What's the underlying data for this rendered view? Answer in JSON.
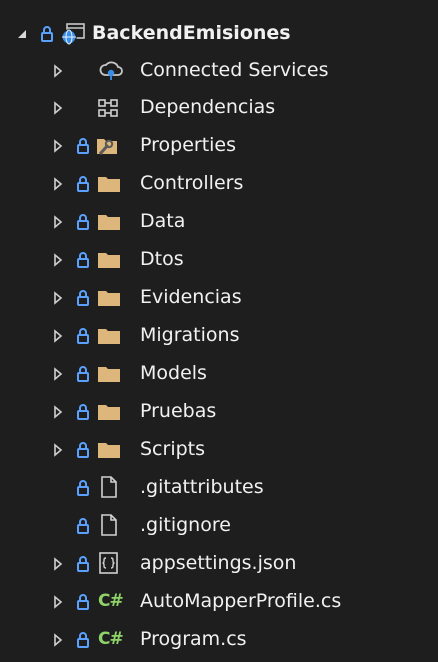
{
  "tree": {
    "project": {
      "name": "BackendEmisiones"
    },
    "items": [
      {
        "label": "Connected Services",
        "icon": "connected-services-icon"
      },
      {
        "label": "Dependencias",
        "icon": "dependencies-icon"
      },
      {
        "label": "Properties",
        "icon": "properties-folder-icon"
      },
      {
        "label": "Controllers",
        "icon": "folder-icon"
      },
      {
        "label": "Data",
        "icon": "folder-icon"
      },
      {
        "label": "Dtos",
        "icon": "folder-icon"
      },
      {
        "label": "Evidencias",
        "icon": "folder-icon"
      },
      {
        "label": "Migrations",
        "icon": "folder-icon"
      },
      {
        "label": "Models",
        "icon": "folder-icon"
      },
      {
        "label": "Pruebas",
        "icon": "folder-icon"
      },
      {
        "label": "Scripts",
        "icon": "folder-icon"
      },
      {
        "label": ".gitattributes",
        "icon": "file-icon"
      },
      {
        "label": ".gitignore",
        "icon": "file-icon"
      },
      {
        "label": "appsettings.json",
        "icon": "json-file-icon"
      },
      {
        "label": "AutoMapperProfile.cs",
        "icon": "csharp-file-icon",
        "badge": "C#"
      },
      {
        "label": "Program.cs",
        "icon": "csharp-file-icon",
        "badge": "C#"
      }
    ]
  },
  "colors": {
    "background": "#1e1e1e",
    "text": "#f1f1f1",
    "chevron": "#cfcfcf",
    "lock": "#5aa0ff",
    "folder": "#dcb67a",
    "csharp": "#8ed36a"
  }
}
